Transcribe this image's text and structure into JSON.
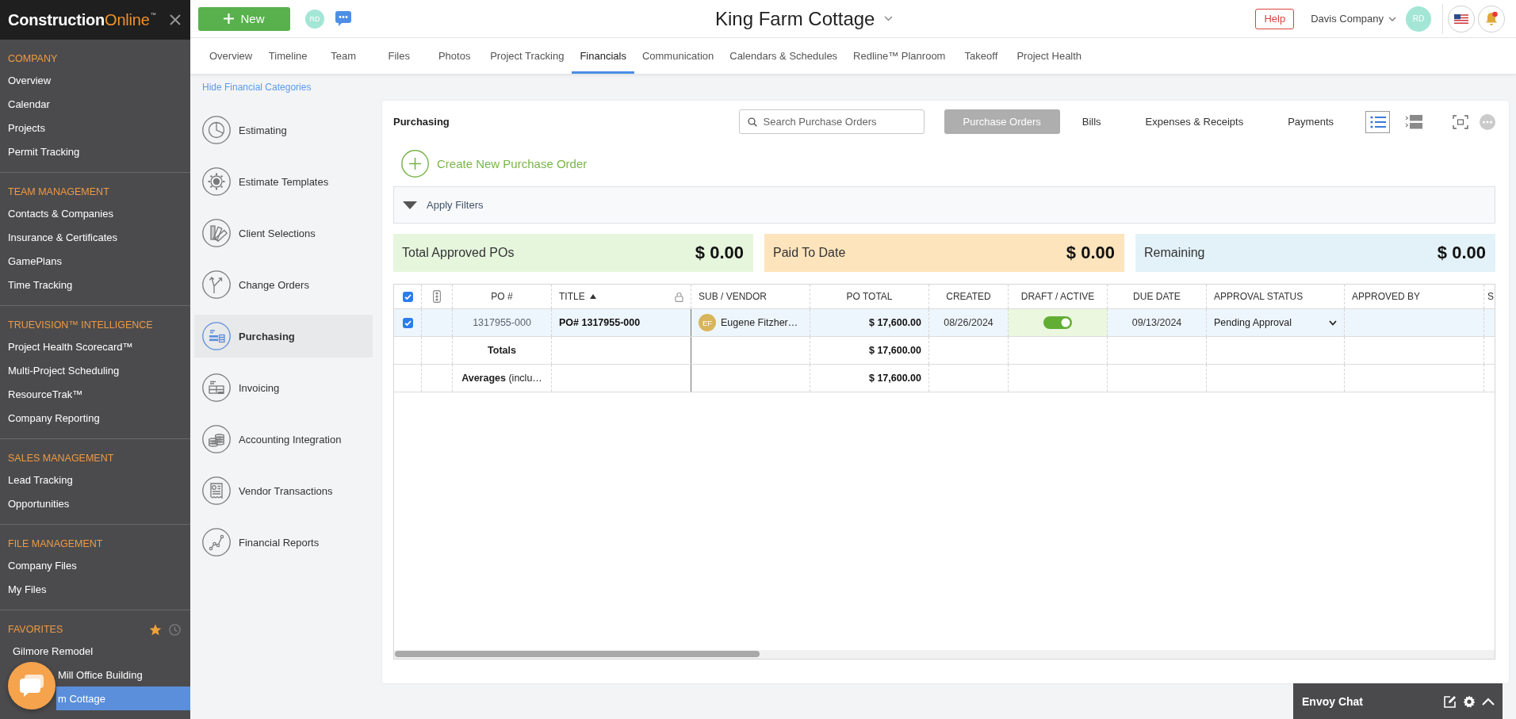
{
  "sidebar": {
    "logo": "**Construction**Online$^{™}$",
    "sections": [
      {
        "title": "COMPANY",
        "items": [
          {
            "label": "Overview",
            "selected": false
          },
          {
            "label": "Calendar",
            "selected": false
          },
          {
            "label": "Projects",
            "selected": false
          },
          {
            "label": "Permit Tracking",
            "selected": false
          }
        ]
      },
      {
        "title": "TEAM MANAGEMENT",
        "items": [
          {
            "label": "Contacts & Companies",
            "selected": false
          },
          {
            "label": "Insurance & Certificates",
            "selected": false
          },
          {
            "label": "GamePlans",
            "selected": false
          },
          {
            "label": "Time Tracking",
            "selected": false
          }
        ]
      },
      {
        "title": "TRUEVISION™ INTELLIGENCE",
        "items": [
          {
            "label": "Project Health Scorecard™",
            "selected": false
          },
          {
            "label": "Multi-Project Scheduling",
            "selected": false
          },
          {
            "label": "ResourceTrak™",
            "selected": false
          },
          {
            "label": "Company Reporting",
            "selected": false
          }
        ]
      },
      {
        "title": "SALES MANAGEMENT",
        "items": [
          {
            "label": "Lead Tracking",
            "selected": false
          },
          {
            "label": "Opportunities",
            "selected": false
          }
        ]
      },
      {
        "title": "FILE MANAGEMENT",
        "items": [
          {
            "label": "Company Files",
            "selected": false
          },
          {
            "label": "My Files",
            "selected": false
          }
        ]
      }
    ],
    "favorites": {
      "title": "FAVORITES",
      "items": [
        {
          "label": "Gilmore Remodel",
          "selected": false,
          "covered": false
        },
        {
          "label": "Mill Office Building",
          "selected": false,
          "covered": true
        },
        {
          "label": "m Cottage",
          "selected": true,
          "covered": true
        }
      ]
    }
  },
  "topbar": {
    "new_button": "New",
    "user_avatar": "RD",
    "project_title": "King Farm Cottage",
    "help_button": "Help",
    "company": "Davis Company",
    "account_avatar": "RD"
  },
  "tabs": [
    {
      "label": "Overview",
      "selected": false
    },
    {
      "label": "Timeline",
      "selected": false
    },
    {
      "label": "Team",
      "selected": false
    },
    {
      "label": "Files",
      "selected": false
    },
    {
      "label": "Photos",
      "selected": false
    },
    {
      "label": "Project Tracking",
      "selected": false
    },
    {
      "label": "Financials",
      "selected": true
    },
    {
      "label": "Communication",
      "selected": false
    },
    {
      "label": "Calendars & Schedules",
      "selected": false
    },
    {
      "label": "Redline™ Planroom",
      "selected": false
    },
    {
      "label": "Takeoff",
      "selected": false
    },
    {
      "label": "Project Health",
      "selected": false
    }
  ],
  "categories": {
    "toggle": "Hide Financial Categories",
    "items": [
      {
        "label": "Estimating",
        "kind": "pie",
        "selected": false
      },
      {
        "label": "Estimate Templates",
        "kind": "gear",
        "selected": false
      },
      {
        "label": "Client Selections",
        "kind": "swatches",
        "selected": false
      },
      {
        "label": "Change Orders",
        "kind": "branch",
        "selected": false
      },
      {
        "label": "Purchasing",
        "kind": "form",
        "selected": true
      },
      {
        "label": "Invoicing",
        "kind": "invoice",
        "selected": false
      },
      {
        "label": "Accounting Integration",
        "kind": "coins",
        "selected": false
      },
      {
        "label": "Vendor Transactions",
        "kind": "receipt",
        "selected": false
      },
      {
        "label": "Financial Reports",
        "kind": "trend",
        "selected": false
      }
    ]
  },
  "purchasing": {
    "title": "Purchasing",
    "search": {
      "placeholder": "Search Purchase Orders"
    },
    "views": [
      {
        "label": "Purchase Orders",
        "selected": true
      },
      {
        "label": "Bills",
        "selected": false
      },
      {
        "label": "Expenses & Receipts",
        "selected": false
      },
      {
        "label": "Payments",
        "selected": false
      }
    ],
    "layouts": [
      {
        "kind": "list",
        "selected": true
      },
      {
        "kind": "rows",
        "selected": false
      }
    ],
    "create_button": "Create New Purchase Order",
    "filters": {
      "label": "Apply Filters"
    },
    "summary": [
      {
        "label": "Total Approved POs",
        "value": "$ 0.00",
        "color": "#e6f6dd"
      },
      {
        "label": "Paid To Date",
        "value": "$ 0.00",
        "color": "#fde4bc"
      },
      {
        "label": "Remaining",
        "value": "$ 0.00",
        "color": "#e3f1f8"
      }
    ],
    "table": {
      "columns": [
        {
          "kind": "check",
          "checked": true
        },
        {
          "kind": "signal"
        },
        {
          "kind": "text",
          "label": "PO #"
        },
        {
          "kind": "text",
          "label": "TITLE",
          "sort_ascending": true,
          "locked": true
        },
        {
          "kind": "text",
          "label": "SUB / VENDOR"
        },
        {
          "kind": "text",
          "label": "PO TOTAL"
        },
        {
          "kind": "text",
          "label": "CREATED"
        },
        {
          "kind": "text",
          "label": "DRAFT / ACTIVE"
        },
        {
          "kind": "text",
          "label": "DUE DATE"
        },
        {
          "kind": "text",
          "label": "APPROVAL STATUS"
        },
        {
          "kind": "text",
          "label": "APPROVED BY"
        },
        {
          "kind": "text",
          "label": "S"
        }
      ],
      "rows": [
        {
          "checked": true,
          "po_number": "1317955-000",
          "title": "PO# 1317955-000",
          "vendor": {
            "initials": "EF",
            "name": "Eugene Fitzher…"
          },
          "po_total": "$ 17,600.00",
          "created": "08/26/2024",
          "active": true,
          "due_date": "09/13/2024",
          "approval_status": "Pending Approval"
        }
      ],
      "summary_rows": [
        {
          "kind": "total",
          "label": "Totals",
          "po_total": "$ 17,600.00"
        },
        {
          "kind": "average",
          "label": "**Averages** (inclu…",
          "po_total": "$ 17,600.00"
        }
      ]
    }
  },
  "envoy_chat": {
    "title": "Envoy Chat"
  }
}
